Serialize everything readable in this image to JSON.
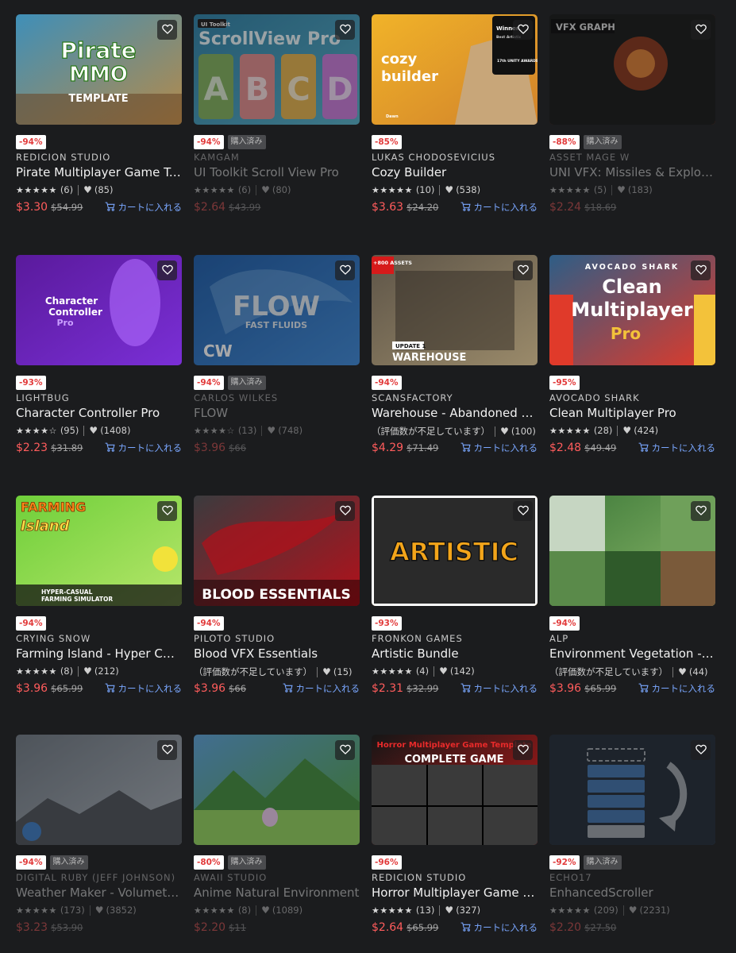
{
  "labels": {
    "add_to_cart": "カートに入れる",
    "owned": "購入済み",
    "not_enough_ratings": "（評価数が不足しています）"
  },
  "products": [
    {
      "publisher": "REDICION STUDIO",
      "title": "Pirate Multiplayer Game Template",
      "discount": "-94%",
      "owned": false,
      "stars": "★★★★★",
      "reviews": "(6)",
      "favorites": "(85)",
      "price": "$3.30",
      "original_price": "$54.99",
      "thumb_text": [
        "Pirate",
        "MMO",
        "TEMPLATE"
      ],
      "thumb_colors": [
        "#3f8fb8",
        "#b48a4a",
        "#6a4a2a"
      ]
    },
    {
      "publisher": "KAMGAM",
      "title": "UI Toolkit Scroll View Pro",
      "discount": "-94%",
      "owned": true,
      "stars": "★★★★★",
      "reviews": "(6)",
      "favorites": "(80)",
      "price": "$2.64",
      "original_price": "$43.99",
      "thumb_text": [
        "UI Toolkit",
        "ScrollView Pro",
        "A",
        "B",
        "C",
        "D"
      ],
      "thumb_colors": [
        "#2b7fa6",
        "#54b0c9",
        "#1d5e7c"
      ]
    },
    {
      "publisher": "LUKAS CHODOSEVICIUS",
      "title": "Cozy Builder",
      "discount": "-85%",
      "owned": false,
      "stars": "★★★★★",
      "reviews": "(10)",
      "favorites": "(538)",
      "price": "$3.63",
      "original_price": "$24.20",
      "thumb_text": [
        "cozy",
        "builder",
        "Winner",
        "Best Artistic",
        "17th UNITY AWARDS",
        "Dawn"
      ],
      "thumb_colors": [
        "#f1b329",
        "#d1822a",
        "#c8a679"
      ]
    },
    {
      "publisher": "ASSET MAGE W",
      "title": "UNI VFX: Missiles & Explosions",
      "discount": "-88%",
      "owned": true,
      "stars": "★★★★★",
      "reviews": "(5)",
      "favorites": "(183)",
      "price": "$2.24",
      "original_price": "$18.69",
      "thumb_text": [
        "VFX GRAPH"
      ],
      "thumb_colors": [
        "#141414",
        "#e04a18",
        "#ff9a3c"
      ]
    },
    {
      "publisher": "LIGHTBUG",
      "title": "Character Controller Pro",
      "discount": "-93%",
      "owned": false,
      "stars": "★★★★☆",
      "reviews": "(95)",
      "favorites": "(1408)",
      "price": "$2.23",
      "original_price": "$31.89",
      "thumb_text": [
        "Character",
        "Controller",
        "Pro"
      ],
      "thumb_colors": [
        "#5a1a9c",
        "#7a2fd6",
        "#b06cff"
      ]
    },
    {
      "publisher": "CARLOS WILKES",
      "title": "FLOW",
      "discount": "-94%",
      "owned": true,
      "stars": "★★★★☆",
      "reviews": "(13)",
      "favorites": "(748)",
      "price": "$3.96",
      "original_price": "$66",
      "thumb_text": [
        "FLOW",
        "FAST FLUIDS",
        "CW"
      ],
      "thumb_colors": [
        "#1a5aa8",
        "#3a86d6",
        "#8fc4f0"
      ]
    },
    {
      "publisher": "SCANSFACTORY",
      "title": "Warehouse - Abandoned Factory",
      "discount": "-94%",
      "owned": false,
      "stars": "",
      "reviews": "",
      "favorites": "(100)",
      "price": "$4.29",
      "original_price": "$71.49",
      "thumb_text": [
        "+800 ASSETS",
        "UPDATE 1",
        "WAREHOUSE"
      ],
      "thumb_colors": [
        "#5e5548",
        "#9a8a6a",
        "#2f2a24"
      ]
    },
    {
      "publisher": "AVOCADO SHARK",
      "title": "Clean Multiplayer Pro",
      "discount": "-95%",
      "owned": false,
      "stars": "★★★★★",
      "reviews": "(28)",
      "favorites": "(424)",
      "price": "$2.48",
      "original_price": "$49.49",
      "thumb_text": [
        "AVOCADO SHARK",
        "Clean",
        "Multiplayer",
        "Pro"
      ],
      "thumb_colors": [
        "#2e5d86",
        "#e03a2a",
        "#f3c23a"
      ]
    },
    {
      "publisher": "CRYING SNOW",
      "title": "Farming Island - Hyper Casual",
      "discount": "-94%",
      "owned": false,
      "stars": "★★★★★",
      "reviews": "(8)",
      "favorites": "(212)",
      "price": "$3.96",
      "original_price": "$65.99",
      "thumb_text": [
        "FARMING",
        "Island",
        "HYPER-CASUAL",
        "FARMING SIMULATOR"
      ],
      "thumb_colors": [
        "#6fcf3a",
        "#b6e66a",
        "#f2e23a"
      ]
    },
    {
      "publisher": "PILOTO STUDIO",
      "title": "Blood VFX Essentials",
      "discount": "-94%",
      "owned": false,
      "stars": "",
      "reviews": "",
      "favorites": "(15)",
      "price": "$3.96",
      "original_price": "$66",
      "thumb_text": [
        "BLOOD ESSENTIALS"
      ],
      "thumb_colors": [
        "#3b3b3e",
        "#b3101a",
        "#7a2fd6"
      ]
    },
    {
      "publisher": "FRONKON GAMES",
      "title": "Artistic Bundle",
      "discount": "-93%",
      "owned": false,
      "stars": "★★★★★",
      "reviews": "(4)",
      "favorites": "(142)",
      "price": "$2.31",
      "original_price": "$32.99",
      "thumb_text": [
        "ARTISTIC"
      ],
      "thumb_colors": [
        "#2a2a2a",
        "#f3a51a",
        "#2aa3e0"
      ]
    },
    {
      "publisher": "ALP",
      "title": "Environment Vegetation - Nature Pack",
      "discount": "-94%",
      "owned": false,
      "stars": "",
      "reviews": "",
      "favorites": "(44)",
      "price": "$3.96",
      "original_price": "$65.99",
      "thumb_text": [],
      "thumb_colors": [
        "#3f7a3a",
        "#8bb86a",
        "#c6d6c2"
      ]
    },
    {
      "publisher": "DIGITAL RUBY (JEFF JOHNSON)",
      "title": "Weather Maker - Volumetric Clouds",
      "discount": "-94%",
      "owned": true,
      "stars": "★★★★★",
      "reviews": "(173)",
      "favorites": "(3852)",
      "price": "$3.23",
      "original_price": "$53.90",
      "thumb_text": [],
      "thumb_colors": [
        "#6d7680",
        "#a9b0b8",
        "#4a4f55"
      ]
    },
    {
      "publisher": "AWAII STUDIO",
      "title": "Anime Natural Environment",
      "discount": "-80%",
      "owned": true,
      "stars": "★★★★★",
      "reviews": "(8)",
      "favorites": "(1089)",
      "price": "$2.20",
      "original_price": "$11",
      "thumb_text": [],
      "thumb_colors": [
        "#5aa0d6",
        "#4fa53a",
        "#8fd05a"
      ]
    },
    {
      "publisher": "REDICION STUDIO",
      "title": "Horror Multiplayer Game Template",
      "discount": "-96%",
      "owned": false,
      "stars": "★★★★★",
      "reviews": "(13)",
      "favorites": "(327)",
      "price": "$2.64",
      "original_price": "$65.99",
      "thumb_text": [
        "Horror Multiplayer Game Template",
        "COMPLETE GAME"
      ],
      "thumb_colors": [
        "#161616",
        "#c81a1a",
        "#3a3a3a"
      ]
    },
    {
      "publisher": "ECHO17",
      "title": "EnhancedScroller",
      "discount": "-92%",
      "owned": true,
      "stars": "★★★★★",
      "reviews": "(209)",
      "favorites": "(2231)",
      "price": "$2.20",
      "original_price": "$27.50",
      "thumb_text": [],
      "thumb_colors": [
        "#1f2833",
        "#3e6fa8",
        "#9aa0a6"
      ]
    }
  ]
}
